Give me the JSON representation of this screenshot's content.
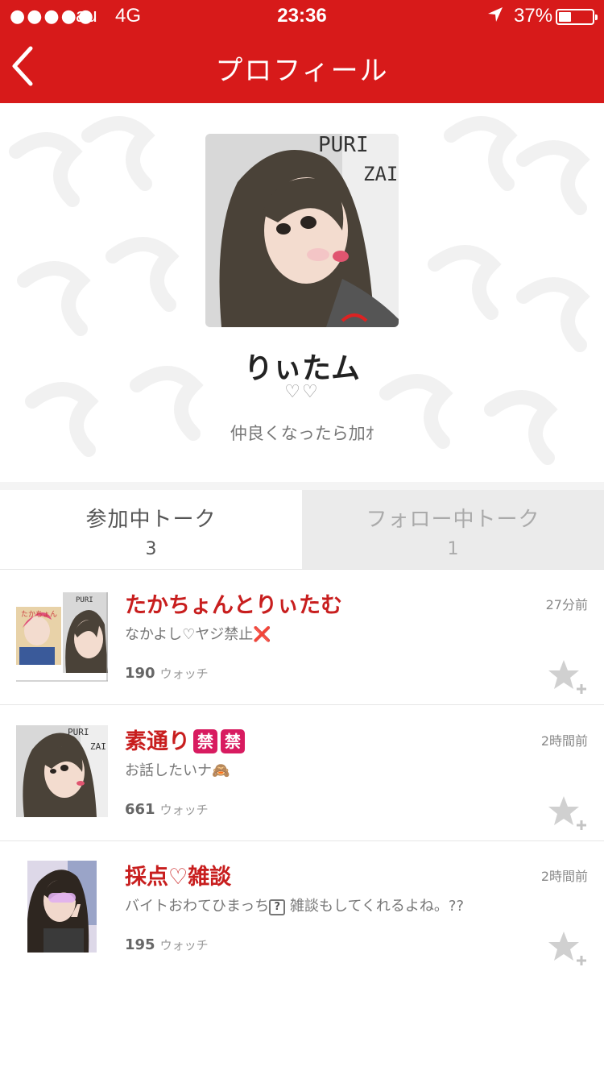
{
  "status_bar": {
    "signal": "●●●●●",
    "carrier": "au",
    "network": "4G",
    "time": "23:36",
    "battery_percent_label": "37%",
    "battery_level": 0.37
  },
  "nav": {
    "back_icon": "chevron-left-icon",
    "title": "プロフィール"
  },
  "profile": {
    "name": "りぃたム",
    "hearts": "♡♡",
    "bio": "仲良くなったら加ｵ"
  },
  "tabs": [
    {
      "label": "参加中トーク",
      "count": "3"
    },
    {
      "label": "フォロー中トーク",
      "count": "1"
    }
  ],
  "talks": [
    {
      "title": "たかちょんとりぃたむ",
      "desc": "なかよし♡ヤジ禁止",
      "desc_emoji": "❌",
      "time": "27分前",
      "watch_count": "190",
      "watch_label": "ウォッチ"
    },
    {
      "title": "素通り",
      "title_badge": "禁",
      "desc": "お話したいナ",
      "desc_emoji": "🙈",
      "time": "2時間前",
      "watch_count": "661",
      "watch_label": "ウォッチ"
    },
    {
      "title": "採点♡雑談",
      "desc_before": "バイトおわてひまっち",
      "desc_box": "?",
      "desc_after": " 雑談もしてくれるよね。??",
      "time": "2時間前",
      "watch_count": "195",
      "watch_label": "ウォッチ"
    }
  ],
  "colors": {
    "brand_red": "#d71a1a",
    "title_red": "#c81e1e"
  }
}
